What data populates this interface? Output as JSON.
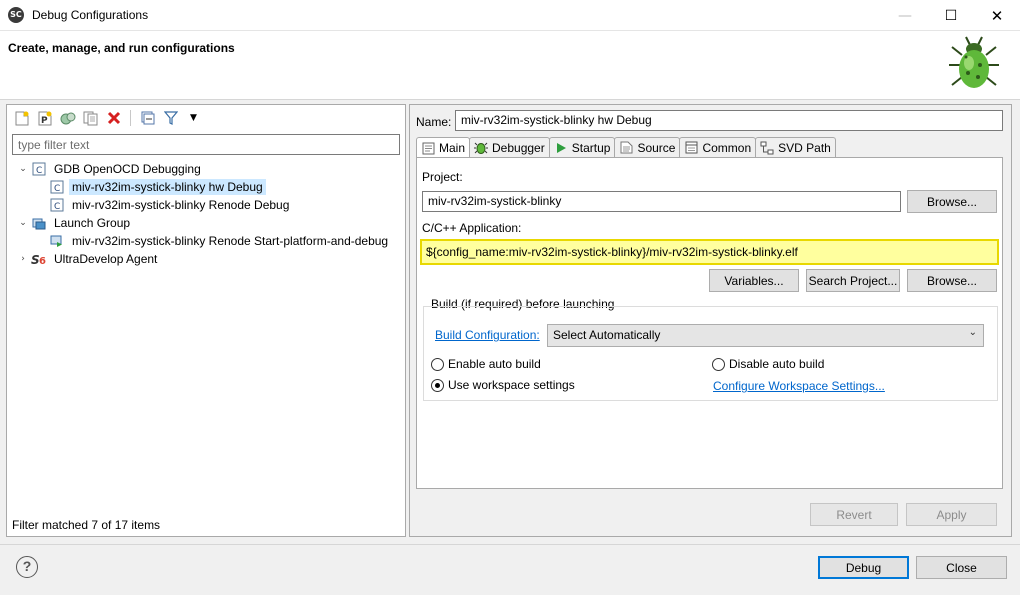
{
  "window": {
    "title": "Debug Configurations",
    "app_icon_text": "SC"
  },
  "header": {
    "title": "Create, manage, and run configurations"
  },
  "left": {
    "filter_placeholder": "type filter text",
    "tree": [
      {
        "label": "GDB OpenOCD Debugging",
        "level": 0,
        "expanded": true,
        "icon": "c-config-icon"
      },
      {
        "label": "miv-rv32im-systick-blinky hw Debug",
        "level": 1,
        "selected": true,
        "icon": "c-file-icon"
      },
      {
        "label": "miv-rv32im-systick-blinky Renode Debug",
        "level": 1,
        "icon": "c-file-icon"
      },
      {
        "label": "Launch Group",
        "level": 0,
        "expanded": true,
        "icon": "launch-group-icon"
      },
      {
        "label": "miv-rv32im-systick-blinky Renode Start-platform-and-debug",
        "level": 1,
        "icon": "launch-item-icon"
      },
      {
        "label": "UltraDevelop Agent",
        "level": 0,
        "expanded": false,
        "icon": "sc-agent-icon"
      }
    ],
    "status": "Filter matched 7 of 17 items"
  },
  "right": {
    "name_label": "Name:",
    "name_value": "miv-rv32im-systick-blinky hw Debug",
    "tabs": [
      {
        "label": "Main",
        "icon": "main-tab-icon",
        "active": true
      },
      {
        "label": "Debugger",
        "icon": "bug-icon"
      },
      {
        "label": "Startup",
        "icon": "play-icon"
      },
      {
        "label": "Source",
        "icon": "source-icon"
      },
      {
        "label": "Common",
        "icon": "common-icon"
      },
      {
        "label": "SVD Path",
        "icon": "svd-icon"
      }
    ],
    "project_label": "Project:",
    "project_value": "miv-rv32im-systick-blinky",
    "browse_label": "Browse...",
    "app_label": "C/C++ Application:",
    "app_value": "${config_name:miv-rv32im-systick-blinky}/miv-rv32im-systick-blinky.elf",
    "variables_label": "Variables...",
    "search_project_label": "Search Project...",
    "build_group_title": "Build (if required) before launching",
    "build_config_link": "Build Configuration:",
    "build_config_value": "Select Automatically",
    "enable_auto_build": "Enable auto build",
    "disable_auto_build": "Disable auto build",
    "use_workspace_settings": "Use workspace settings",
    "configure_workspace_link": "Configure Workspace Settings...",
    "revert_label": "Revert",
    "apply_label": "Apply"
  },
  "footer": {
    "debug_label": "Debug",
    "close_label": "Close",
    "help_symbol": "?"
  }
}
